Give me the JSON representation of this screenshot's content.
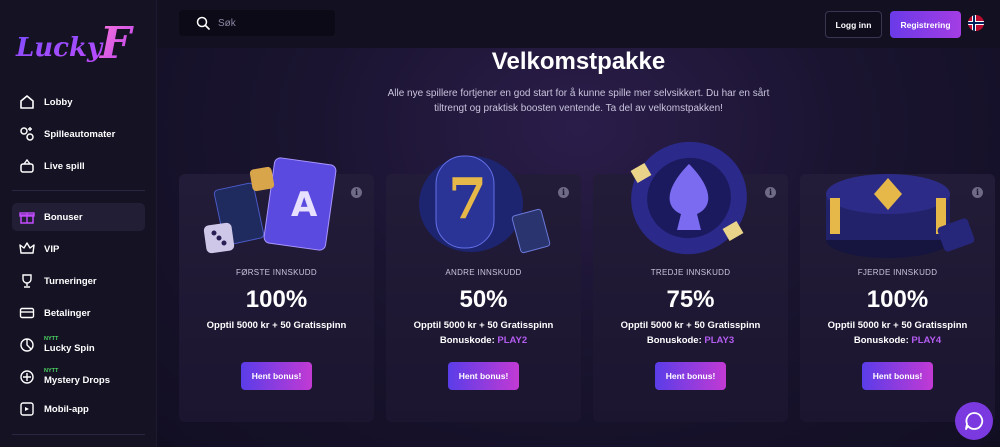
{
  "brand": {
    "name": "LuckyF",
    "accent": "#8b3ee6"
  },
  "sidebar": {
    "items": [
      {
        "label": "Lobby",
        "icon": "home-icon"
      },
      {
        "label": "Spilleautomater",
        "icon": "slots-icon"
      },
      {
        "label": "Live spill",
        "icon": "live-icon"
      },
      {
        "label": "Bonuser",
        "icon": "gift-icon",
        "active": true
      },
      {
        "label": "VIP",
        "icon": "crown-icon"
      },
      {
        "label": "Turneringer",
        "icon": "trophy-icon"
      },
      {
        "label": "Betalinger",
        "icon": "card-icon"
      },
      {
        "label": "Lucky Spin",
        "icon": "spin-icon",
        "badge": "NYTT"
      },
      {
        "label": "Mystery Drops",
        "icon": "drops-icon",
        "badge": "NYTT"
      },
      {
        "label": "Mobil-app",
        "icon": "mobile-icon"
      }
    ]
  },
  "header": {
    "search_placeholder": "Søk",
    "login_label": "Logg inn",
    "register_label": "Registrering",
    "flag": "norway-flag-icon"
  },
  "main": {
    "title": "Velkomstpakke",
    "subtitle": "Alle nye spillere fortjener en god start for å kunne spille mer selvsikkert. Du har en sårt tiltrengt og praktisk boosten ventende. Ta del av velkomstpakken!",
    "cards": [
      {
        "label": "FØRSTE INNSKUDD",
        "percent": "100%",
        "offer": "Opptil 5000 kr + 50 Gratisspinn",
        "code_label": "",
        "code": "",
        "button": "Hent bonus!"
      },
      {
        "label": "ANDRE INNSKUDD",
        "percent": "50%",
        "offer": "Opptil 5000 kr + 50 Gratisspinn",
        "code_label": "Bonuskode:",
        "code": "PLAY2",
        "button": "Hent bonus!"
      },
      {
        "label": "TREDJE INNSKUDD",
        "percent": "75%",
        "offer": "Opptil 5000 kr + 50 Gratisspinn",
        "code_label": "Bonuskode:",
        "code": "PLAY3",
        "button": "Hent bonus!"
      },
      {
        "label": "FJERDE INNSKUDD",
        "percent": "100%",
        "offer": "Opptil 5000 kr + 50 Gratisspinn",
        "code_label": "Bonuskode:",
        "code": "PLAY4",
        "button": "Hent bonus!"
      }
    ]
  }
}
